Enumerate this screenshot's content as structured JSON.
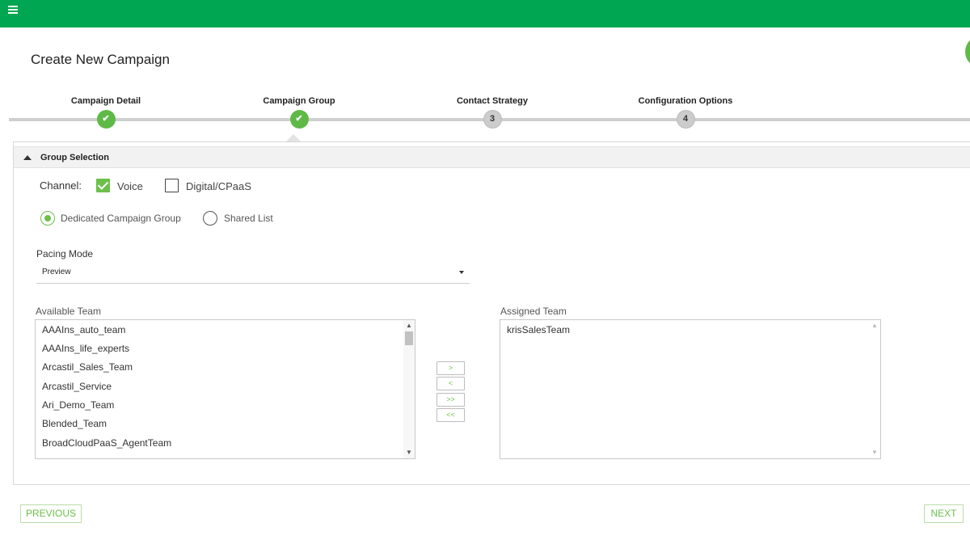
{
  "header": {
    "menu_icon": "hamburger-menu-icon",
    "brand_color": "#00a651"
  },
  "page": {
    "title": "Create New Campaign"
  },
  "stepper": {
    "steps": [
      {
        "label": "Campaign Detail",
        "state": "done",
        "marker": "✔"
      },
      {
        "label": "Campaign Group",
        "state": "done",
        "marker": "✔"
      },
      {
        "label": "Contact Strategy",
        "state": "pending",
        "marker": "3"
      },
      {
        "label": "Configuration Options",
        "state": "pending",
        "marker": "4"
      }
    ],
    "done_color": "#5fb946",
    "pending_color": "#cccccc"
  },
  "group_selection": {
    "title": "Group Selection",
    "channel": {
      "label": "Channel:",
      "options": [
        {
          "label": "Voice",
          "checked": true
        },
        {
          "label": "Digital/CPaaS",
          "checked": false
        }
      ]
    },
    "group_type": {
      "options": [
        {
          "label": "Dedicated Campaign Group",
          "selected": true
        },
        {
          "label": "Shared List",
          "selected": false
        }
      ]
    },
    "pacing": {
      "label": "Pacing Mode",
      "value": "Preview"
    },
    "available_team": {
      "label": "Available Team",
      "items": [
        "AAAIns_auto_team",
        "AAAIns_life_experts",
        "Arcastil_Sales_Team",
        "Arcastil_Service",
        "Ari_Demo_Team",
        "Blended_Team",
        "BroadCloudPaaS_AgentTeam"
      ]
    },
    "assigned_team": {
      "label": "Assigned Team",
      "items": [
        "krisSalesTeam"
      ]
    },
    "move_buttons": {
      "add": ">",
      "remove": "<",
      "add_all": ">>",
      "remove_all": "<<"
    }
  },
  "footer": {
    "previous_label": "PREVIOUS",
    "next_label": "NEXT"
  },
  "accent_color": "#6cc04a"
}
